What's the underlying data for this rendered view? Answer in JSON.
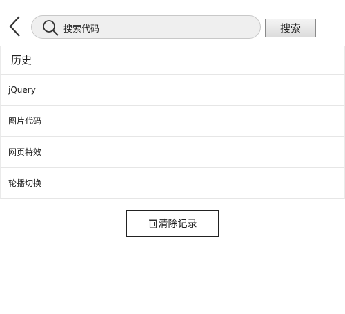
{
  "search": {
    "value": "搜索代码",
    "button_label": "搜索"
  },
  "history": {
    "title": "历史",
    "items": [
      {
        "label": "jQuery"
      },
      {
        "label": "图片代码"
      },
      {
        "label": "网页特效"
      },
      {
        "label": "轮播切换"
      }
    ],
    "clear_label": "清除记录"
  },
  "icons": {
    "back": "chevron-left-icon",
    "search": "magnifier-icon",
    "clear": "trash-icon"
  }
}
